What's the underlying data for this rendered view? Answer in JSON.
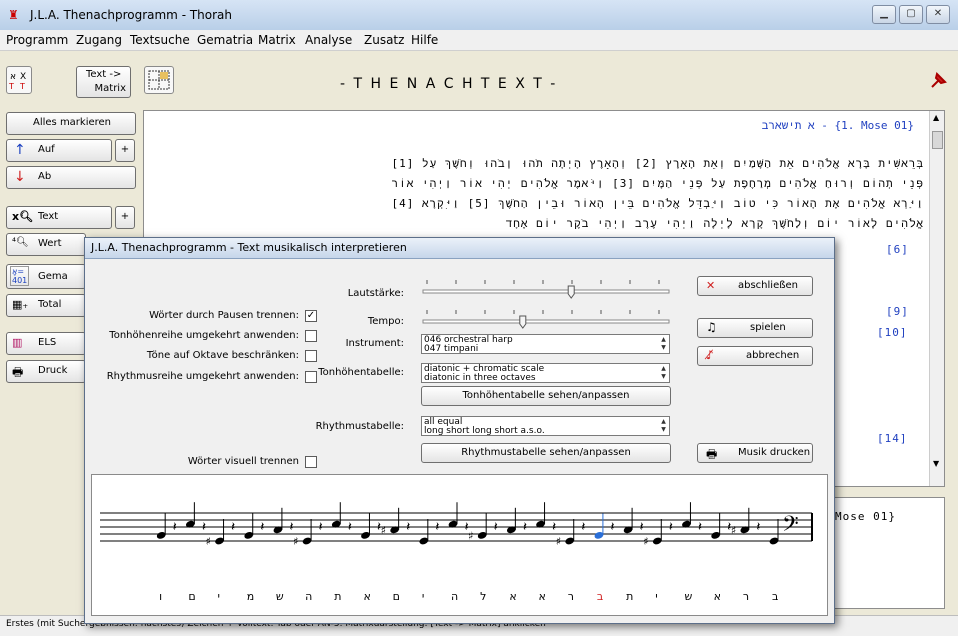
{
  "window": {
    "title": "J.L.A. Thenachprogramm - Thorah",
    "controls": [
      "minimize",
      "maximize",
      "close"
    ]
  },
  "menu": [
    "Programm",
    "Zugang",
    "Textsuche",
    "Gematria",
    "Matrix",
    "Analyse",
    "Zusatz",
    "Hilfe"
  ],
  "toolbar": {
    "text_matrix_line1": "Text ->",
    "text_matrix_line2": "Matrix",
    "header": "- T H E N A C H T E X T -"
  },
  "sidebar": {
    "buttons": [
      {
        "label": "Alles markieren"
      },
      {
        "label": "Auf",
        "plus": "+"
      },
      {
        "label": "Ab"
      },
      {
        "label": "Text",
        "plus": "+"
      },
      {
        "label": "Wert"
      },
      {
        "label": "Gema"
      },
      {
        "label": "Total"
      },
      {
        "label": "ELS"
      },
      {
        "label": "Druck"
      }
    ]
  },
  "text_panel": {
    "ref_line": "א תישארב - {1. Mose 01}",
    "lines": [
      "[1] בְּרֵאשִׁית בָּרָא אֱלֹהִים אֵת הַשָּׁמַיִם וְאֵת הָאָרֶץ [2] וְהָאָרֶץ הָיְתָה תֹהוּ וָבֹהוּ וְחֹשֶׁךְ עַל",
      "פְּנֵי תְהוֹם וְרוּחַ אֱלֹהִים מְרַחֶפֶת עַל פְּנֵי הַמָּיִם [3] וַיֹּאמֶר אֱלֹהִים יְהִי אוֹר וַיְהִי אוֹר",
      "[4] וַיַּרְא אֱלֹהִים אֶת הָאוֹר כִּי טוֹב וַיַּבְדֵּל אֱלֹהִים בֵּין הָאוֹר וּבֵין הַחֹשֶׁךְ [5] וַיִּקְרָא",
      "אֱלֹהִים לָאוֹר יוֹם וְלַחֹשֶׁךְ קָרָא לָיְלָה וַיְהִי עֶרֶב וַיְהִי בֹקֶר יוֹם אֶחָד"
    ],
    "right_fragments": [
      "[6]",
      "[9]",
      "[10]",
      "[14]"
    ],
    "lower_ref": "Mose 01}"
  },
  "dialog": {
    "title": "J.L.A. Thenachprogramm - Text musikalisch interpretieren",
    "options": [
      {
        "label": "Wörter durch Pausen trennen:",
        "checked": true,
        "mark": "✓"
      },
      {
        "label": "Tonhöhenreihe umgekehrt anwenden:",
        "checked": false,
        "mark": ""
      },
      {
        "label": "Töne auf Oktave beschränken:",
        "checked": false,
        "mark": ""
      },
      {
        "label": "Rhythmusreihe umgekehrt anwenden:",
        "checked": false,
        "mark": ""
      }
    ],
    "visual_split": {
      "label": "Wörter visuell trennen",
      "checked": false
    },
    "lautstaerke": {
      "label": "Lautstärke:",
      "value": 0.6
    },
    "tempo": {
      "label": "Tempo:",
      "value": 0.4
    },
    "instrument": {
      "label": "Instrument:",
      "value": "046 orchestral harp",
      "next": "047 timpani"
    },
    "tonhoehentabelle": {
      "label": "Tonhöhentabelle:",
      "value": "diatonic + chromatic scale",
      "next": "diatonic in three octaves"
    },
    "tonhoehen_btn": "Tonhöhentabelle sehen/anpassen",
    "rhythmustabelle": {
      "label": "Rhythmustabelle:",
      "value": "all equal",
      "next": "long short long short a.s.o."
    },
    "rhythmus_btn": "Rhythmustabelle sehen/anpassen",
    "buttons": {
      "close": "abschließen",
      "play": "spielen",
      "cancel": "abbrechen",
      "print": "Musik drucken"
    }
  },
  "staff": {
    "letters": [
      "ב",
      "ר",
      "א",
      "ש",
      "י",
      "ת",
      "ב",
      "ר",
      "א",
      "א",
      "ל",
      "ה",
      "י",
      "ם",
      "א",
      "ת",
      "ה",
      "ש",
      "מ",
      "י",
      "ם",
      "ו"
    ],
    "highlight_index": 6,
    "highlight_color": "#d02020",
    "note_color_highlight": "#2a6fd8"
  },
  "status": "Erstes (mit Suchergebnissen: nächstes) Zeichen + Volltext: Tab oder AN-5. Matrixdarstellung: [Text -> Matrix] anklicken"
}
